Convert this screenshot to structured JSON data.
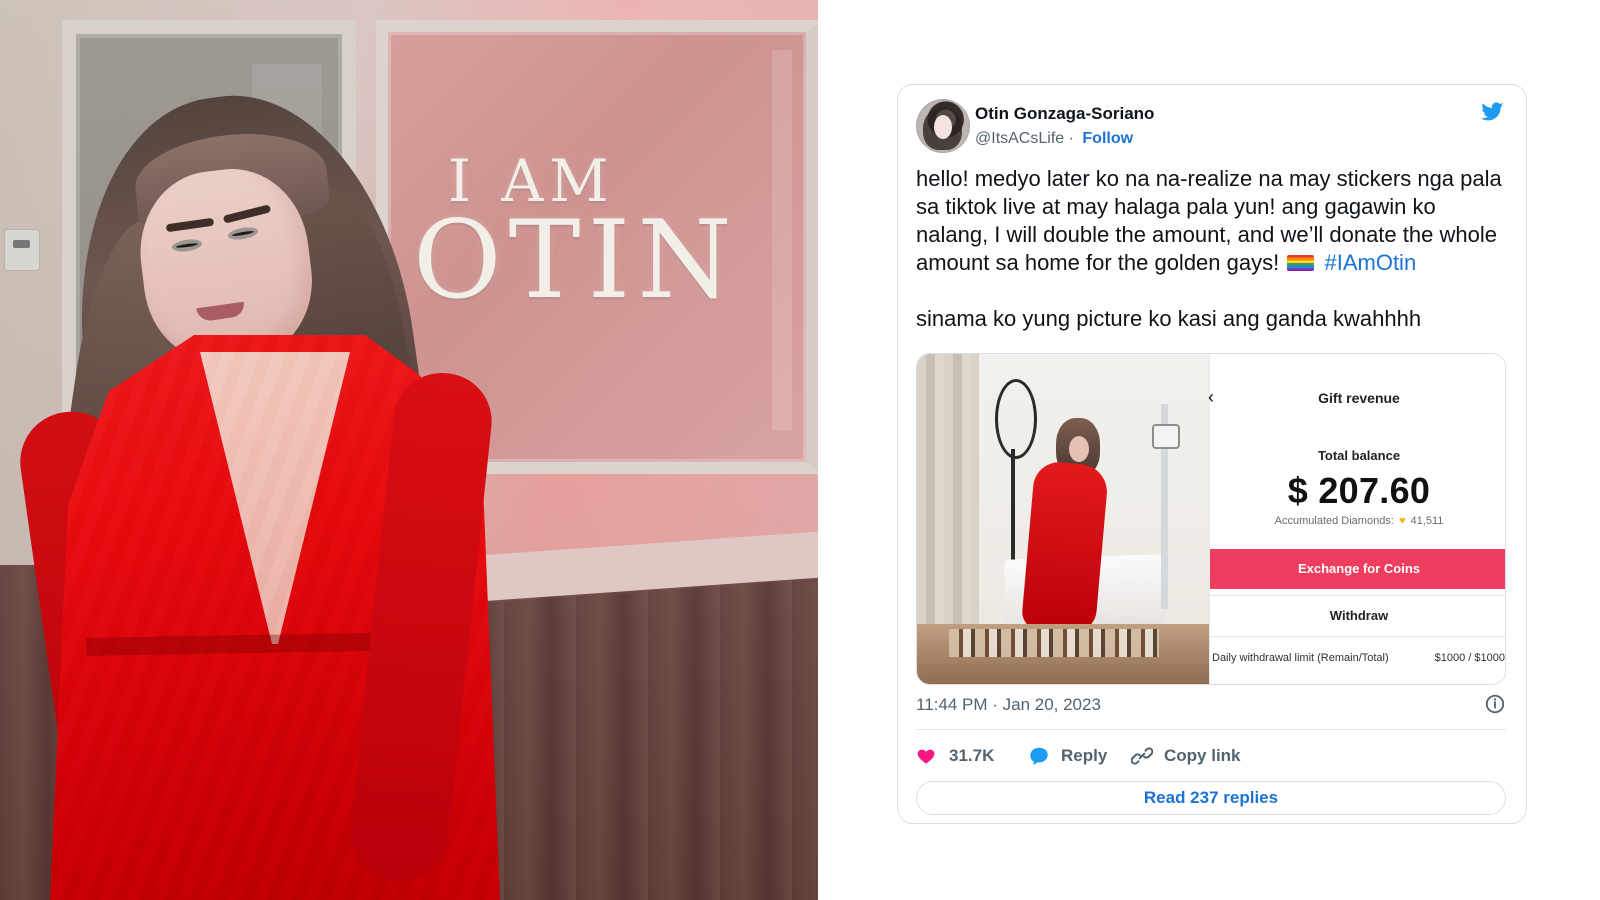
{
  "left_photo": {
    "wall_sign": {
      "line1": "I AM",
      "line2": "OTIN"
    }
  },
  "tweet": {
    "author": {
      "display_name": "Otin Gonzaga-Soriano",
      "handle": "@ItsACsLife",
      "follow_label": "Follow"
    },
    "text_paragraph_1": "hello! medyo later ko na na-realize na may stickers nga pala sa tiktok live at may halaga pala yun! ang gagawin ko nalang, I will double the amount, and we’ll donate the whole amount sa home for the golden gays!",
    "hashtag": "#IAmOtin",
    "text_paragraph_2": "sinama ko yung picture ko kasi ang ganda kwahhhh",
    "media_revenue": {
      "title": "Gift revenue",
      "total_balance_label": "Total balance",
      "balance": "$ 207.60",
      "diamonds_label": "Accumulated Diamonds:",
      "diamonds_value": "41,511",
      "exchange_button": "Exchange for Coins",
      "withdraw_label": "Withdraw",
      "limit_label": "Daily withdrawal limit (Remain/Total)",
      "limit_value": "$1000 / $1000"
    },
    "timestamp": "11:44 PM · Jan 20, 2023",
    "actions": {
      "likes": "31.7K",
      "reply_label": "Reply",
      "copy_link_label": "Copy link"
    },
    "read_replies": "Read 237 replies"
  },
  "colors": {
    "twitter_blue": "#1d9bf0",
    "link_blue": "#1d72d8",
    "like_pink": "#f91880",
    "exchange_red": "#ef3d5f"
  }
}
